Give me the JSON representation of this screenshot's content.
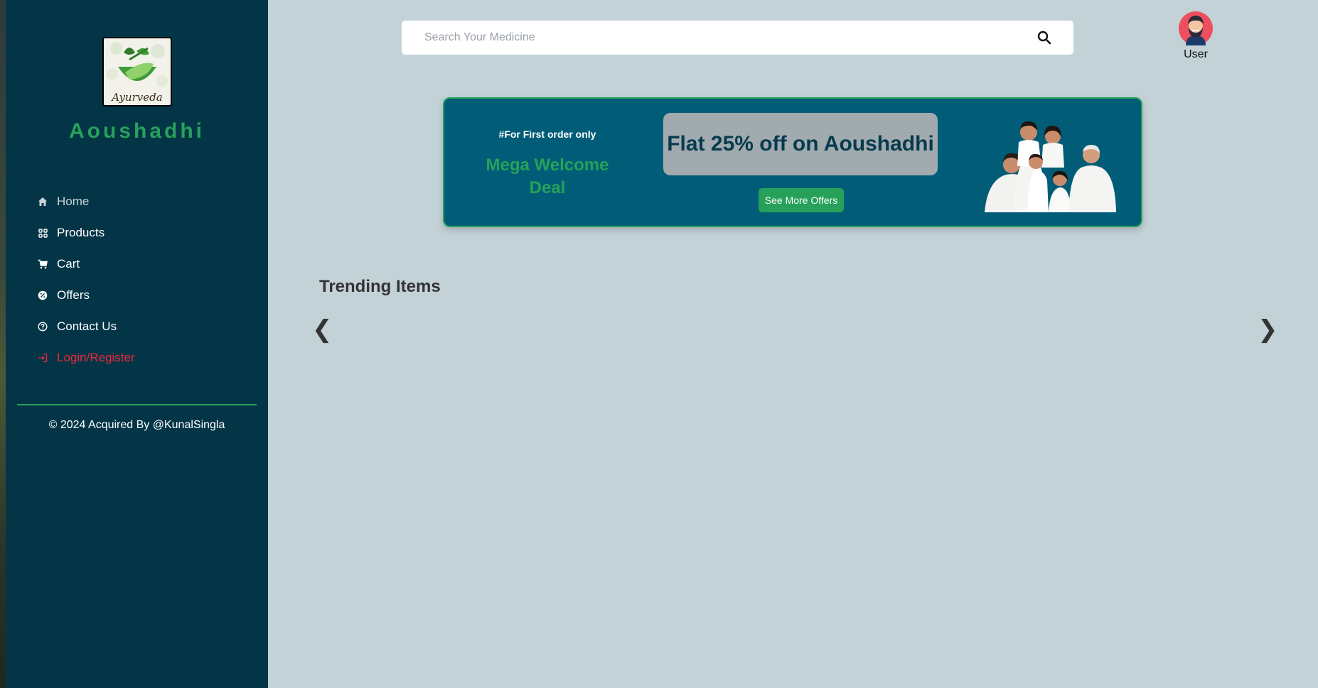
{
  "brand": {
    "name": "Aoushadhi",
    "logo_text": "Ayurveda"
  },
  "search": {
    "placeholder": "Search Your Medicine"
  },
  "user": {
    "label": "User"
  },
  "nav": {
    "items": [
      {
        "label": "Home",
        "icon": "home-icon"
      },
      {
        "label": "Products",
        "icon": "grid-icon"
      },
      {
        "label": "Cart",
        "icon": "cart-icon"
      },
      {
        "label": "Offers",
        "icon": "badge-percent-icon"
      },
      {
        "label": "Contact Us",
        "icon": "support-icon"
      },
      {
        "label": "Login/Register",
        "icon": "login-icon"
      }
    ]
  },
  "footer": {
    "copyright": "© 2024 Acquired By @KunalSingla"
  },
  "banner": {
    "tag": "#For First order only",
    "deal": "Mega Welcome Deal",
    "offer": "Flat 25% off on Aoushadhi",
    "button": "See More Offers"
  },
  "trending": {
    "title": "Trending Items",
    "prev": "❮",
    "next": "❯"
  },
  "colors": {
    "sidebar": "#033547",
    "accent_green": "#27a15a",
    "banner_bg": "#015d77",
    "page_bg": "#c3d2d7",
    "danger": "#e8283a"
  }
}
